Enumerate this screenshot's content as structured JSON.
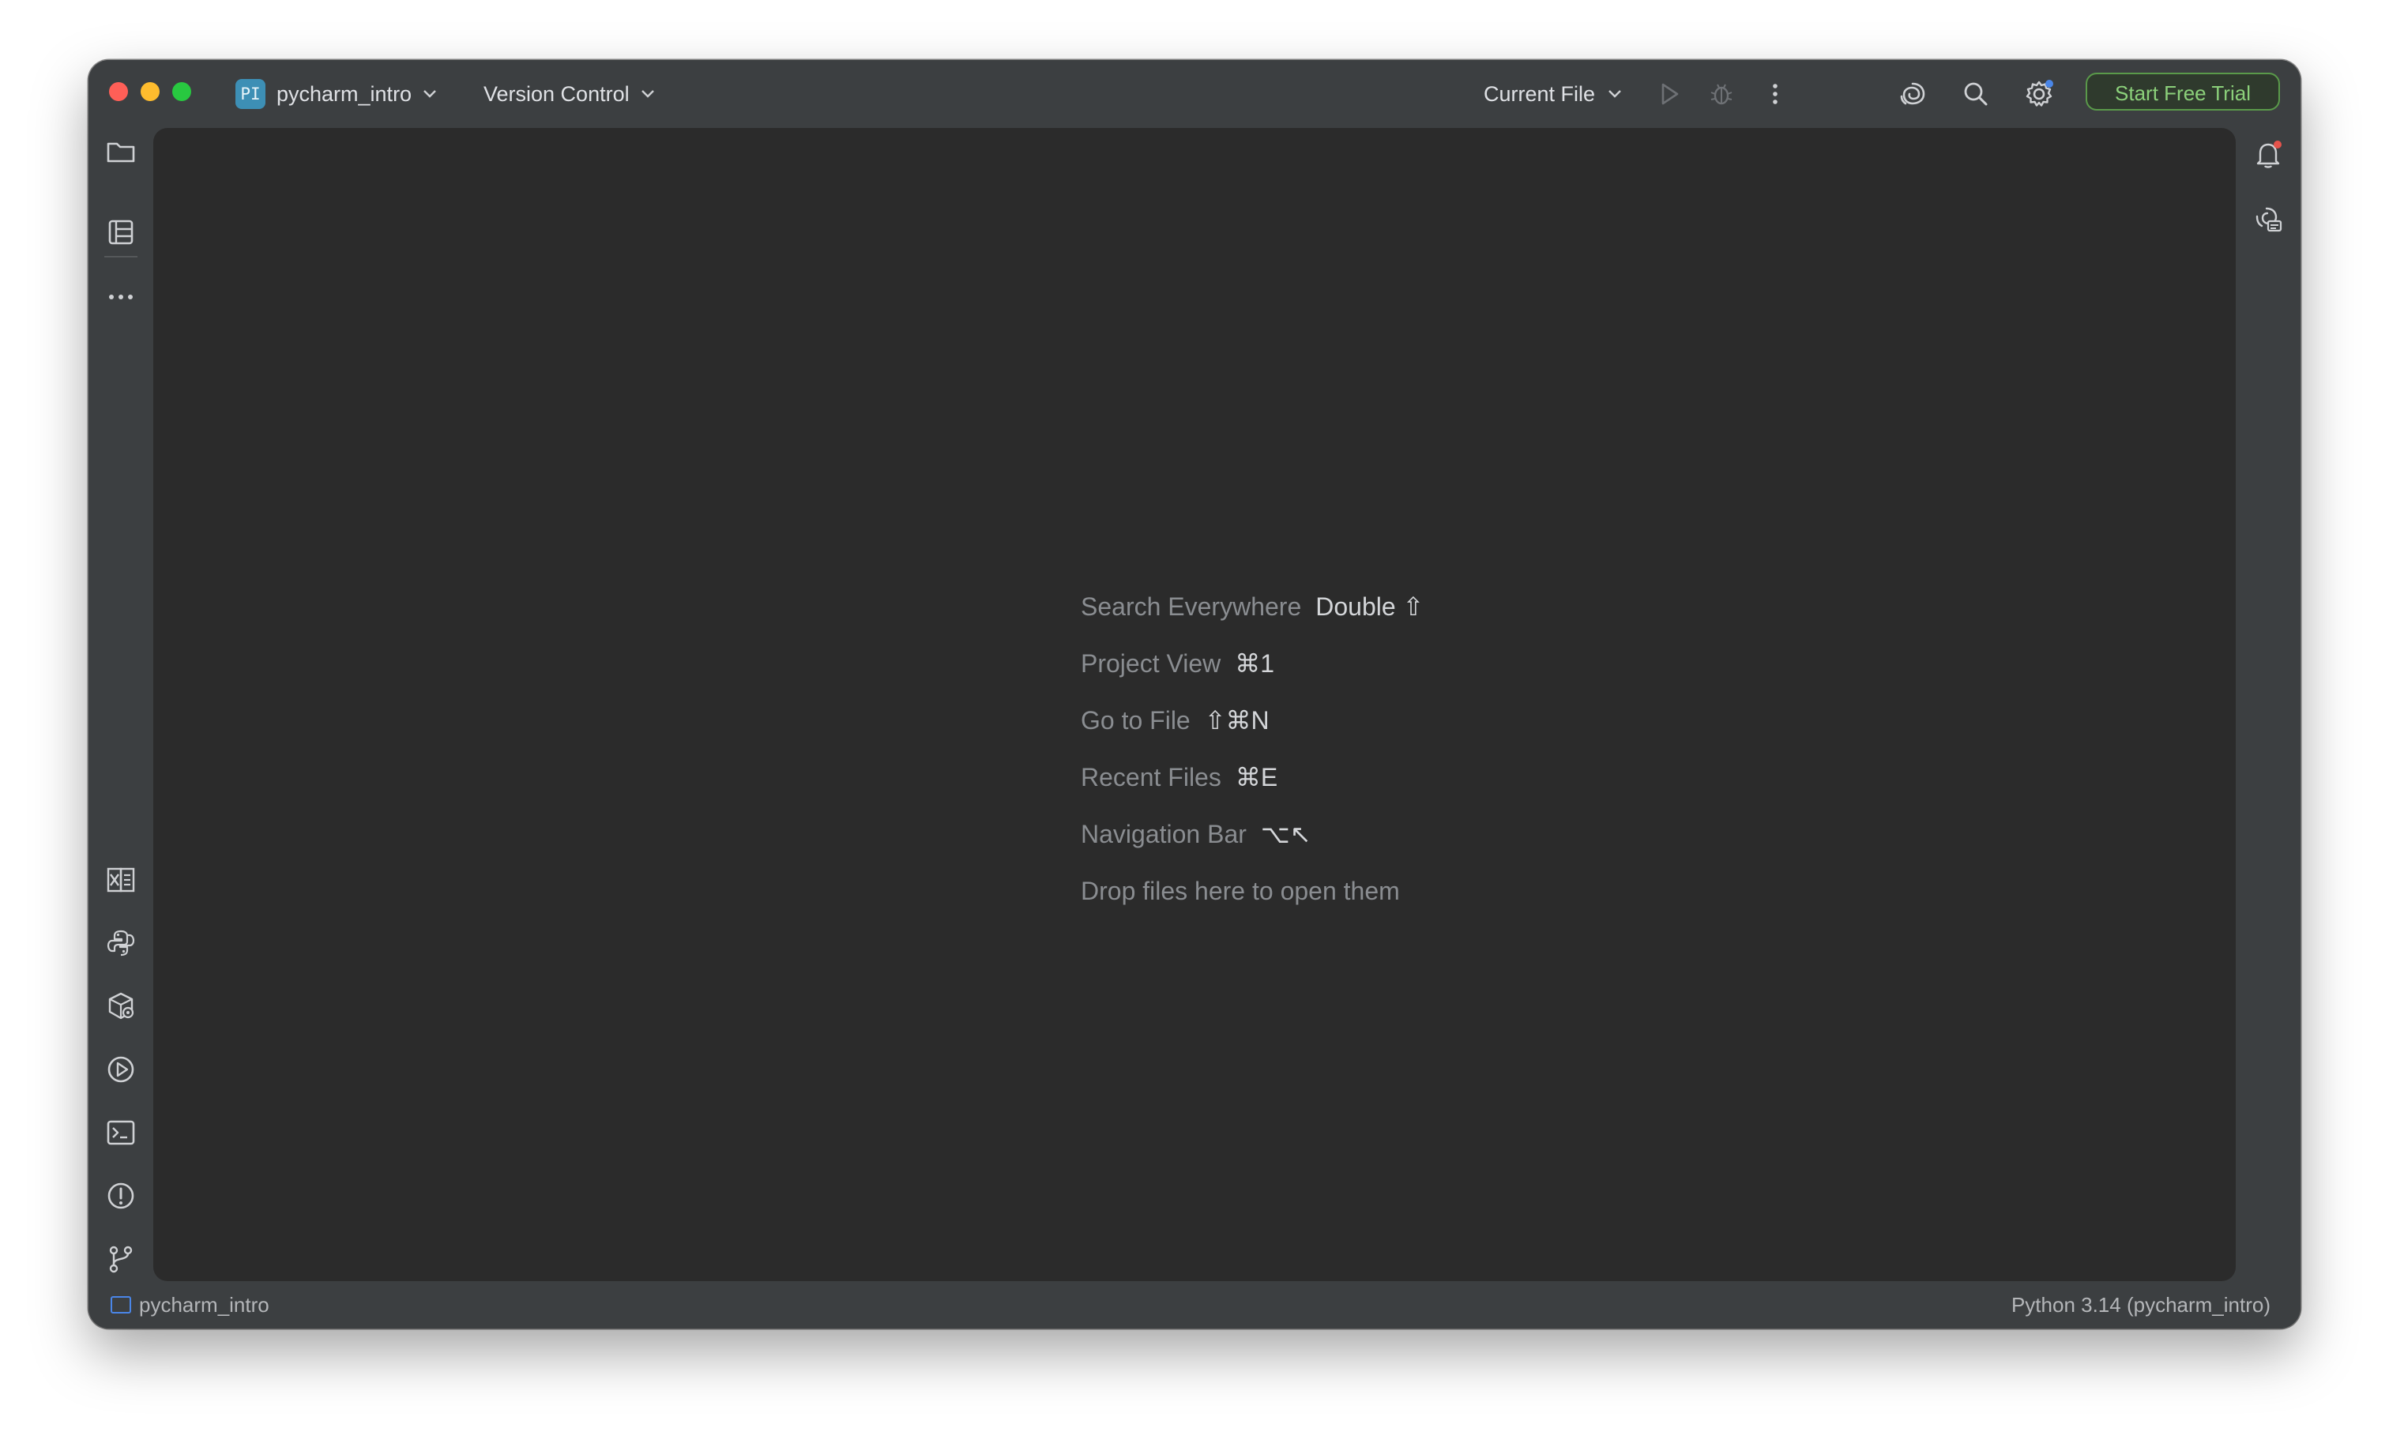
{
  "titlebar": {
    "project_badge": "PI",
    "project_name": "pycharm_intro",
    "version_control": "Version Control",
    "run_config": "Current File",
    "trial_button": "Start Free Trial"
  },
  "icons": {
    "project_switch": "chevron-down-icon",
    "left_top": [
      "folder-icon",
      "structure-icon",
      "more-icon"
    ],
    "left_bottom": [
      "data-view-icon",
      "python-console-icon",
      "python-packages-icon",
      "services-icon",
      "terminal-icon",
      "problems-icon",
      "git-icon"
    ],
    "right": [
      "notifications-icon",
      "ai-assistant-icon"
    ],
    "toolbar": [
      "run-icon",
      "debug-icon",
      "more-vertical-icon",
      "ai-spiral-icon",
      "search-icon",
      "settings-icon"
    ]
  },
  "editor": {
    "hints": [
      {
        "label": "Search Everywhere",
        "shortcut": "Double ⇧"
      },
      {
        "label": "Project View",
        "shortcut": "⌘1"
      },
      {
        "label": "Go to File",
        "shortcut": "⇧⌘N"
      },
      {
        "label": "Recent Files",
        "shortcut": "⌘E"
      },
      {
        "label": "Navigation Bar",
        "shortcut": "⌥↖"
      }
    ],
    "drop_text": "Drop files here to open them"
  },
  "statusbar": {
    "project": "pycharm_intro",
    "interpreter": "Python 3.14 (pycharm_intro)"
  },
  "colors": {
    "window_bg": "#3c3f41",
    "editor_bg": "#2b2b2b",
    "trial_accent": "#8bd07a",
    "badge_bg": "#3d8fb5",
    "notification_dot": "#e5534b",
    "settings_dot": "#4a86e8"
  }
}
